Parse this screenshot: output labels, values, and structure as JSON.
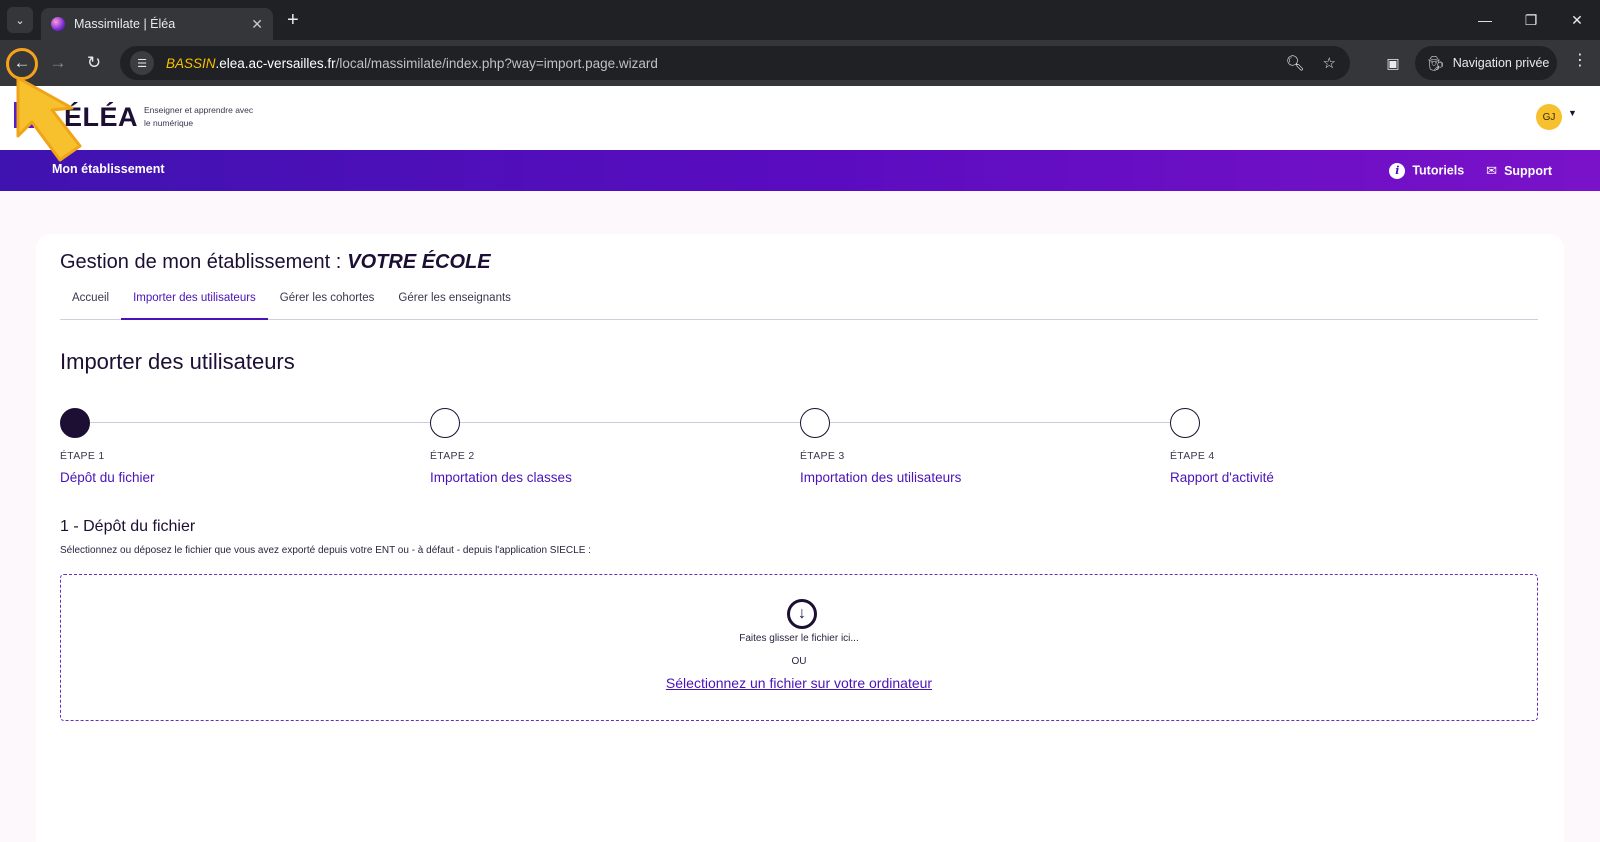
{
  "browser": {
    "tab_title": "Massimilate | Éléa",
    "url_subdomain": "BASSIN",
    "url_host": ".elea.ac-versailles.fr",
    "url_path": "/local/massimilate/index.php?way=import.page.wizard",
    "incognito_label": "Navigation privée"
  },
  "site": {
    "logo_text": "ÉLÉA",
    "tagline": "Enseigner et apprendre avec le numérique",
    "avatar_initials": "GJ"
  },
  "nav": {
    "left_link": "Mon établissement",
    "tutorials": "Tutoriels",
    "support": "Support"
  },
  "page": {
    "title_prefix": "Gestion de mon établissement :",
    "school_name": "VOTRE ÉCOLE",
    "tabs": [
      {
        "label": "Accueil"
      },
      {
        "label": "Importer des utilisateurs"
      },
      {
        "label": "Gérer les cohortes"
      },
      {
        "label": "Gérer les enseignants"
      }
    ],
    "active_tab": "Importer des utilisateurs",
    "section_title": "Importer des utilisateurs"
  },
  "stepper": {
    "current_step": 1,
    "steps": [
      {
        "label": "ÉTAPE 1",
        "name": "Dépôt du fichier"
      },
      {
        "label": "ÉTAPE 2",
        "name": "Importation des classes"
      },
      {
        "label": "ÉTAPE 3",
        "name": "Importation des utilisateurs"
      },
      {
        "label": "ÉTAPE 4",
        "name": "Rapport d'activité"
      }
    ]
  },
  "upload": {
    "title": "1 - Dépôt du fichier",
    "description": "Sélectionnez ou déposez le fichier que vous avez exporté depuis votre ENT ou - à défaut - depuis l'application SIECLE :",
    "drop_text": "Faites glisser le fichier ici...",
    "or_text": "OU",
    "select_link": "Sélectionnez un fichier sur votre ordinateur"
  },
  "colors": {
    "accent": "#4a12b8",
    "nav_gradient_start": "#3f13b0",
    "nav_gradient_end": "#7a12c9",
    "annotation": "#f7c12e"
  }
}
